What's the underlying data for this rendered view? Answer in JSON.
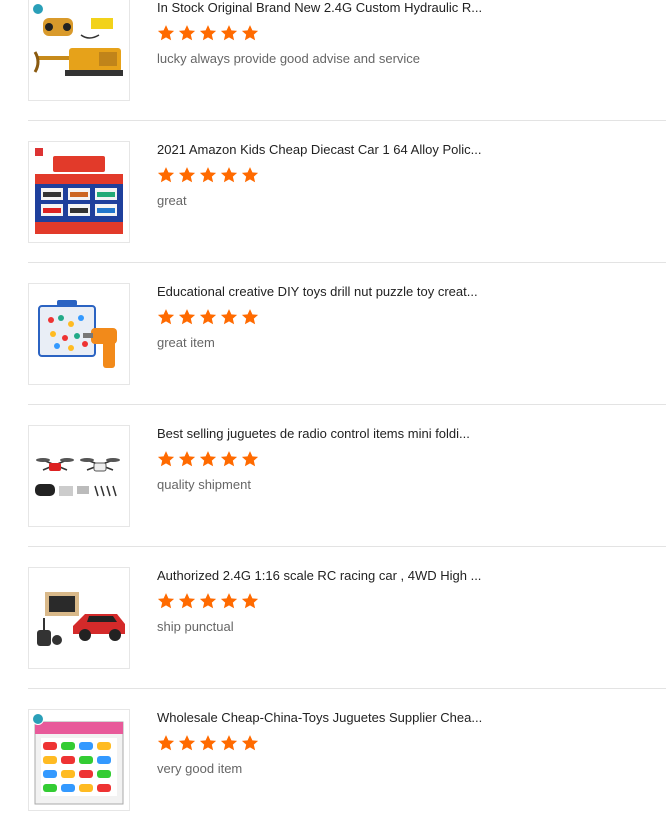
{
  "colors": {
    "star": "#ff6a00",
    "title": "#222222",
    "comment": "#666666",
    "divider": "#e3e3e3"
  },
  "reviews": [
    {
      "title": "In Stock Original Brand New 2.4G Custom Hydraulic R...",
      "rating": 5,
      "comment": "lucky always provide good advise and service",
      "thumb_icon": "rc-excavator-image"
    },
    {
      "title": "2021 Amazon Kids Cheap Diecast Car 1 64 Alloy Polic...",
      "rating": 5,
      "comment": "great",
      "thumb_icon": "diecast-car-box-image"
    },
    {
      "title": "Educational creative DIY toys drill nut puzzle toy creat...",
      "rating": 5,
      "comment": "great item",
      "thumb_icon": "drill-puzzle-toy-image"
    },
    {
      "title": "Best selling juguetes de radio control items mini foldi...",
      "rating": 5,
      "comment": "quality shipment",
      "thumb_icon": "mini-drone-image"
    },
    {
      "title": "Authorized 2.4G 1:16 scale RC racing car , 4WD High ...",
      "rating": 5,
      "comment": "ship punctual",
      "thumb_icon": "rc-racing-car-image"
    },
    {
      "title": "Wholesale Cheap-China-Toys Juguetes Supplier Chea...",
      "rating": 5,
      "comment": "very good item",
      "thumb_icon": "toy-cars-set-image"
    }
  ]
}
